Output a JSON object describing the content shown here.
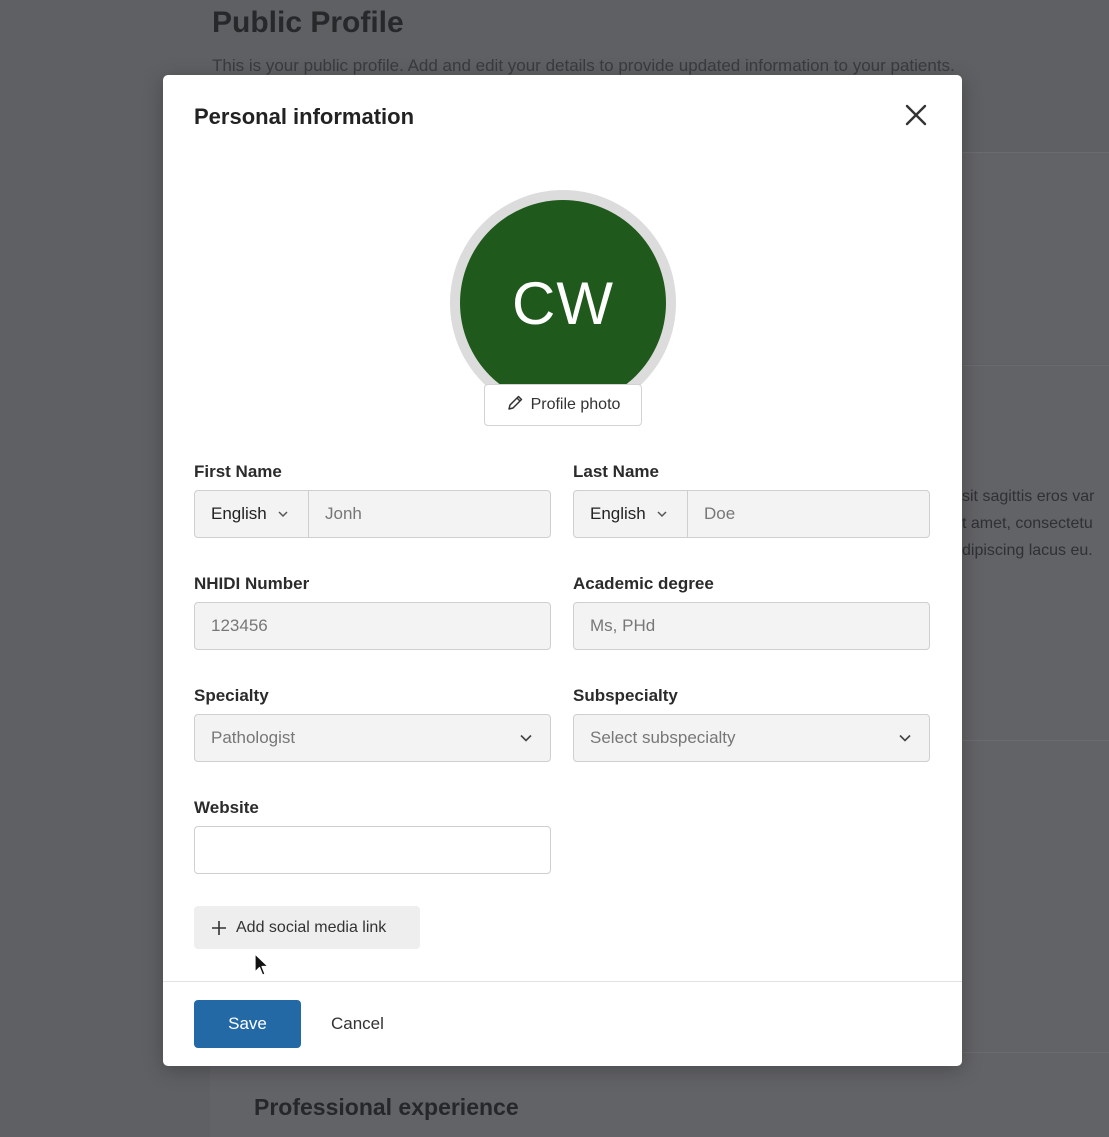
{
  "background": {
    "title": "Public Profile",
    "description": "This is your public profile. Add and edit your details to provide updated information to your patients.",
    "lorem_lines": [
      "sit sagittis eros var",
      "t amet, consectetu",
      "dipiscing lacus eu."
    ],
    "section_title": "Professional experience"
  },
  "modal": {
    "title": "Personal information",
    "close_icon": "close-icon",
    "avatar_initials": "CW",
    "avatar_color": "#1f5a1c",
    "profile_photo_label": "Profile photo",
    "fields": {
      "first_name": {
        "label": "First Name",
        "language": "English",
        "value": "Jonh"
      },
      "last_name": {
        "label": "Last Name",
        "language": "English",
        "value": "Doe"
      },
      "nhidi": {
        "label": "NHIDI Number",
        "value": "123456"
      },
      "academic_degree": {
        "label": "Academic degree",
        "value": "Ms, PHd"
      },
      "specialty": {
        "label": "Specialty",
        "value": "Pathologist"
      },
      "subspecialty": {
        "label": "Subspecialty",
        "placeholder": "Select subspecialty"
      },
      "website": {
        "label": "Website",
        "value": ""
      }
    },
    "add_social_label": "Add social media link",
    "save_label": "Save",
    "cancel_label": "Cancel",
    "accent_color": "#2269a6"
  }
}
